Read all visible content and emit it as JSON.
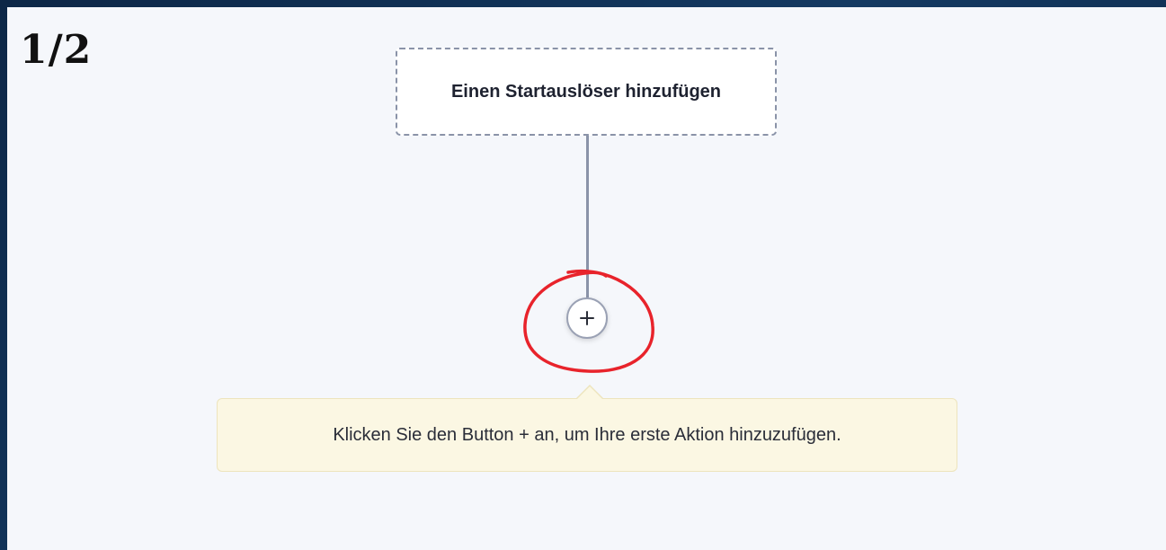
{
  "step_counter": "1/2",
  "workflow": {
    "trigger_label": "Einen Startauslöser hinzufügen",
    "add_button_icon": "plus-icon"
  },
  "tooltip": {
    "text": "Klicken Sie den Button + an, um Ihre erste Aktion hinzuzufügen."
  },
  "colors": {
    "frame": "#0f2a4a",
    "canvas": "#f5f7fb",
    "annotation": "#e8232b",
    "tooltip_bg": "#fbf7e3",
    "connector": "#8a93a8"
  }
}
